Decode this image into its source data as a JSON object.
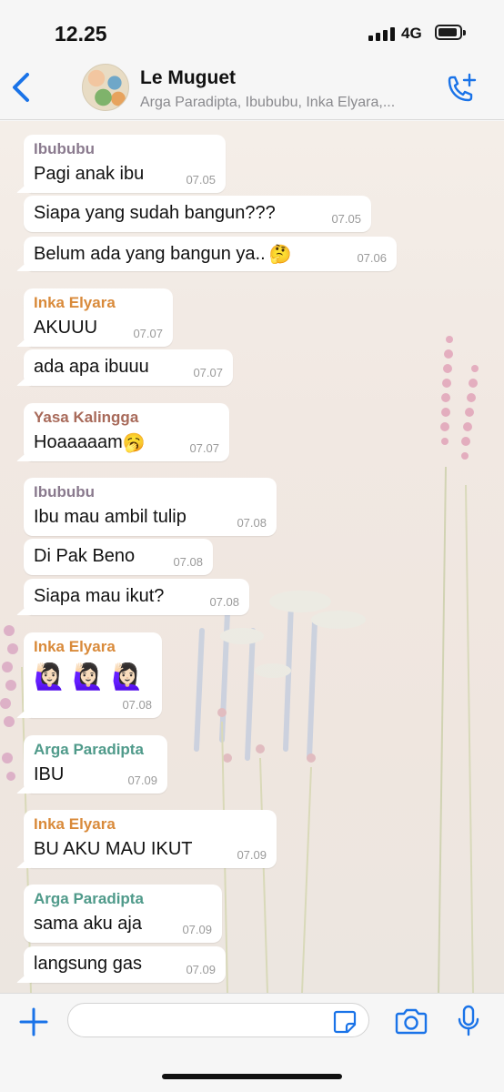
{
  "status_bar": {
    "time": "12.25",
    "network": "4G"
  },
  "header": {
    "title": "Le Muguet",
    "subtitle": "Arga Paradipta, Ibububu, Inka Elyara,...",
    "back_icon": "chevron-left-icon",
    "call_icon": "phone-add-icon"
  },
  "colors": {
    "accent": "#1a73e8",
    "ibububu": "#8a7a8e",
    "inka": "#d98a3a",
    "yasa": "#a86a5a",
    "arga": "#4f9a8a"
  },
  "messages": [
    {
      "sender": "Ibububu",
      "text": "Pagi anak ibu",
      "time": "07.05"
    },
    {
      "text": "Siapa yang sudah bangun???",
      "time": "07.05"
    },
    {
      "text": "Belum ada yang bangun ya..",
      "emoji": "🤔",
      "time": "07.06"
    },
    {
      "sender": "Inka Elyara",
      "text": "AKUUU",
      "time": "07.07"
    },
    {
      "text": "ada apa ibuuu",
      "time": "07.07"
    },
    {
      "sender": "Yasa Kalingga",
      "text": "Hoaaaaam",
      "emoji": "🥱",
      "time": "07.07"
    },
    {
      "sender": "Ibububu",
      "text": "Ibu mau ambil tulip",
      "time": "07.08"
    },
    {
      "text": "Di Pak Beno",
      "time": "07.08"
    },
    {
      "text": "Siapa mau ikut?",
      "time": "07.08"
    },
    {
      "sender": "Inka Elyara",
      "emojis": [
        "🙋🏻‍♀️",
        "🙋🏻‍♀️",
        "🙋🏻‍♀️"
      ],
      "time": "07.08"
    },
    {
      "sender": "Arga Paradipta",
      "text": "IBU",
      "time": "07.09"
    },
    {
      "sender": "Inka Elyara",
      "text": "BU AKU MAU IKUT",
      "time": "07.09"
    },
    {
      "sender": "Arga Paradipta",
      "text": "sama aku aja",
      "time": "07.09"
    },
    {
      "text": "langsung gas",
      "time": "07.09"
    }
  ],
  "input_bar": {
    "placeholder": "",
    "icons": [
      "plus-icon",
      "sticker-icon",
      "camera-icon",
      "microphone-icon"
    ]
  }
}
